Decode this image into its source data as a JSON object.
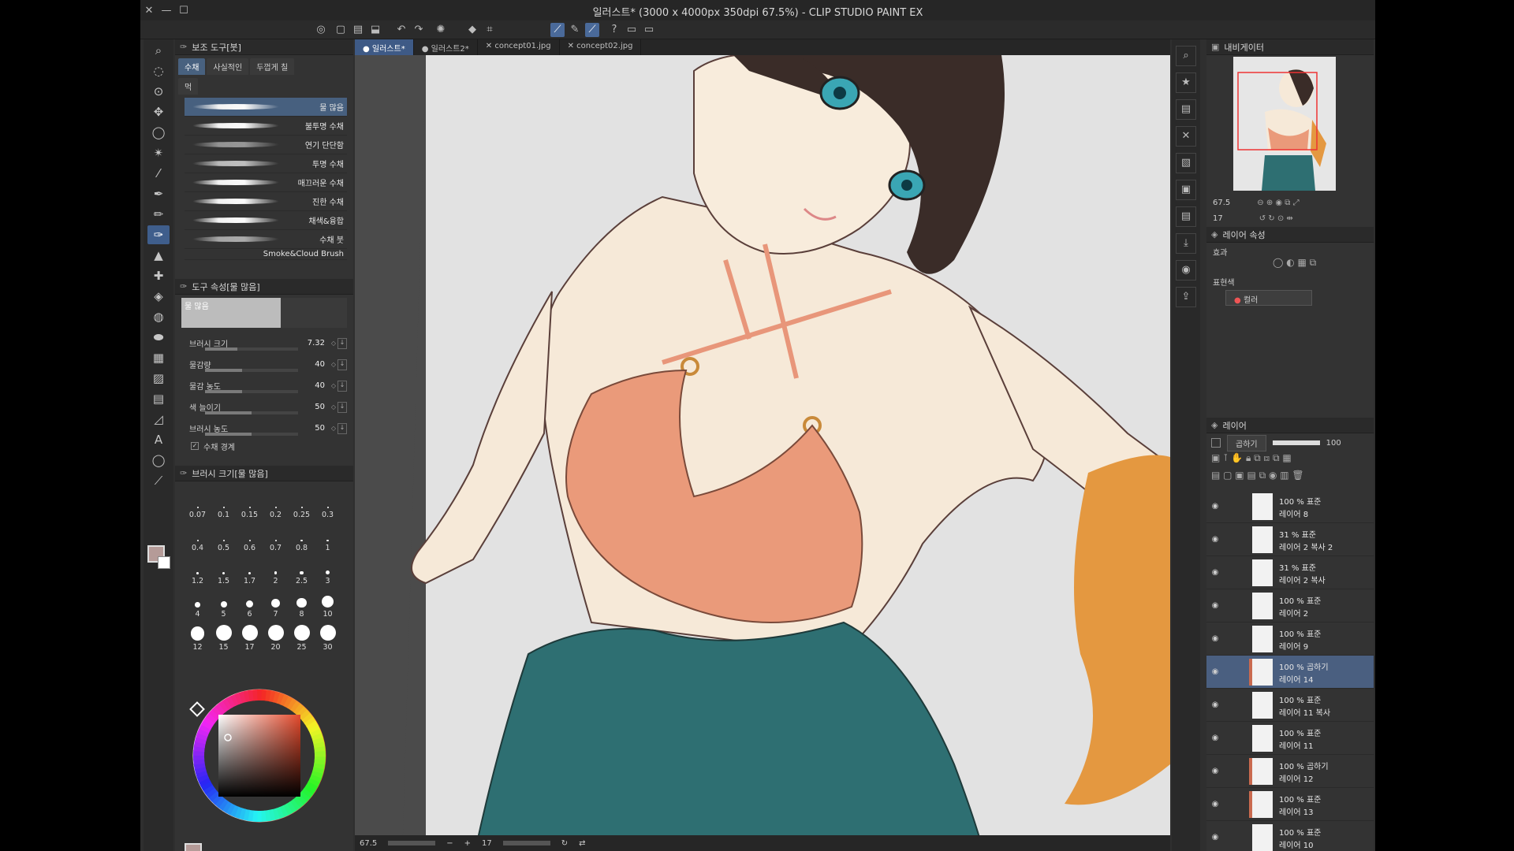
{
  "window": {
    "title": "일러스트* (3000 x 4000px 350dpi 67.5%) - CLIP STUDIO PAINT EX",
    "buttons": [
      "✕",
      "—",
      "☐"
    ]
  },
  "doc_tabs": [
    {
      "label": "● 일러스트*",
      "active": true
    },
    {
      "label": "● 일러스트2*",
      "active": false
    },
    {
      "label": "✕ concept01.jpg",
      "active": false
    },
    {
      "label": "✕ concept02.jpg",
      "active": false
    }
  ],
  "subtool": {
    "header": "보조 도구[붓]",
    "tabs": [
      "수채",
      "사실적인",
      "두껍게 칠"
    ],
    "extra_tab": "먹",
    "brushes": [
      "물 많음",
      "불투명 수채",
      "연기 단단함",
      "투명 수채",
      "매끄러운 수채",
      "진한 수채",
      "채색&융합",
      "수채 붓",
      "Smoke&Cloud Brush"
    ]
  },
  "tool_property": {
    "header": "도구 속성[물 많음]",
    "preview_label": "물 많음",
    "rows": [
      {
        "label": "브러시 크기",
        "value": "7.32",
        "fill": 0.35
      },
      {
        "label": "물감량",
        "value": "40",
        "fill": 0.4
      },
      {
        "label": "물감 농도",
        "value": "40",
        "fill": 0.4
      },
      {
        "label": "색 늘이기",
        "value": "50",
        "fill": 0.5
      },
      {
        "label": "브러시 농도",
        "value": "50",
        "fill": 0.5
      }
    ],
    "checkbox_label": "수채 경계"
  },
  "brush_size": {
    "header": "브러시 크기[물 많음]",
    "sizes": [
      "0.07",
      "0.1",
      "0.15",
      "0.2",
      "0.25",
      "0.3",
      "0.4",
      "0.5",
      "0.6",
      "0.7",
      "0.8",
      "1",
      "1.2",
      "1.5",
      "1.7",
      "2",
      "2.5",
      "3",
      "4",
      "5",
      "6",
      "7",
      "8",
      "10",
      "12",
      "15",
      "17",
      "20",
      "25",
      "30"
    ]
  },
  "color": {
    "rgb": [
      "181",
      "155",
      "152"
    ],
    "main_color": "#b59b98"
  },
  "navigator": {
    "header": "내비게이터",
    "zoom": "67.5",
    "angle": "17"
  },
  "layer_property": {
    "header": "레이어 속성",
    "effect_label": "효과",
    "expression_label": "표현색",
    "expression_value": "컬러"
  },
  "layers_panel": {
    "header": "레이어",
    "blend_mode": "곱하기",
    "opacity": "100",
    "layers": [
      {
        "pct": "100 % 표준",
        "name": "레이어 8",
        "active": false,
        "color": ""
      },
      {
        "pct": "31 % 표준",
        "name": "레이어 2 복사 2",
        "active": false,
        "color": ""
      },
      {
        "pct": "31 % 표준",
        "name": "레이어 2 복사",
        "active": false,
        "color": ""
      },
      {
        "pct": "100 % 표준",
        "name": "레이어 2",
        "active": false,
        "color": ""
      },
      {
        "pct": "100 % 표준",
        "name": "레이어 9",
        "active": false,
        "color": ""
      },
      {
        "pct": "100 % 곱하기",
        "name": "레이어 14",
        "active": true,
        "color": "#c96a4f"
      },
      {
        "pct": "100 % 표준",
        "name": "레이어 11 복사",
        "active": false,
        "color": ""
      },
      {
        "pct": "100 % 표준",
        "name": "레이어 11",
        "active": false,
        "color": ""
      },
      {
        "pct": "100 % 곱하기",
        "name": "레이어 12",
        "active": false,
        "color": "#c96a4f"
      },
      {
        "pct": "100 % 표준",
        "name": "레이어 13",
        "active": false,
        "color": "#c96a4f"
      },
      {
        "pct": "100 % 표준",
        "name": "레이어 10",
        "active": false,
        "color": ""
      }
    ]
  },
  "status": {
    "zoom": "67.5",
    "angle": "17"
  }
}
